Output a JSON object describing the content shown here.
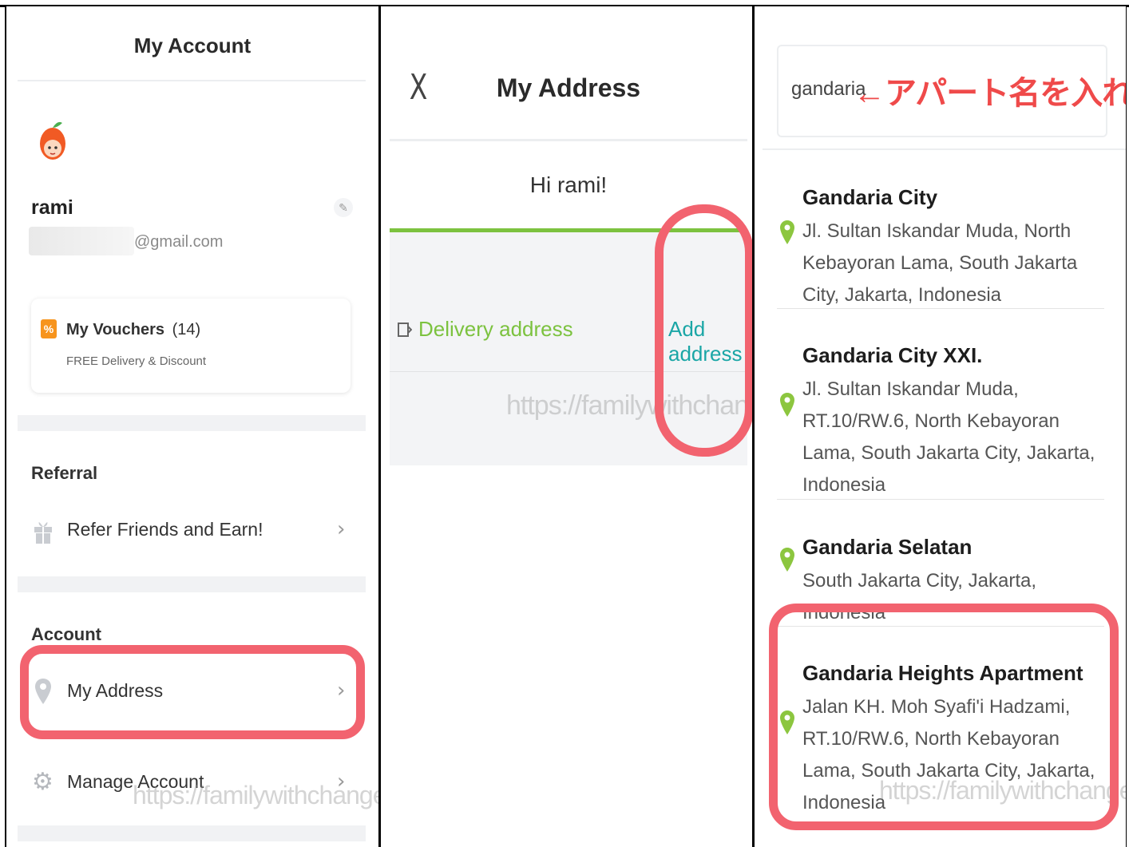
{
  "account": {
    "title": "My Account",
    "user_name": "rami",
    "email_suffix": "@gmail.com",
    "vouchers": {
      "label": "My Vouchers",
      "count": "(14)",
      "subtitle": "FREE Delivery & Discount"
    },
    "referral_heading": "Referral",
    "refer_label": "Refer Friends and Earn!",
    "account_heading": "Account",
    "my_address_label": "My Address",
    "manage_account_label": "Manage Account"
  },
  "address": {
    "close_label": "X",
    "title": "My Address",
    "greeting": "Hi rami!",
    "delivery_label": "Delivery address",
    "add_label": "Add address"
  },
  "search": {
    "query": "gandaria",
    "annotation": "←アパート名を入れる",
    "results": [
      {
        "name": "Gandaria City",
        "address": "Jl. Sultan Iskandar Muda, North Kebayoran Lama, South Jakarta City, Jakarta, Indonesia"
      },
      {
        "name": "Gandaria City XXI.",
        "address": "Jl. Sultan Iskandar Muda, RT.10/RW.6, North Kebayoran Lama, South Jakarta City, Jakarta, Indonesia"
      },
      {
        "name": "Gandaria Selatan",
        "address": "South Jakarta City, Jakarta, Indonesia"
      },
      {
        "name": "Gandaria Heights Apartment",
        "address": "Jalan KH. Moh Syafi'i Hadzami, RT.10/RW.6, North Kebayoran Lama, South Jakarta City, Jakarta, Indonesia"
      }
    ]
  },
  "watermark": "https://familywithchanges.com",
  "colors": {
    "accent_green": "#7cc23f",
    "link_teal": "#1aa6a6",
    "highlight_red": "#f2636f",
    "pin_green": "#8cc63f"
  }
}
